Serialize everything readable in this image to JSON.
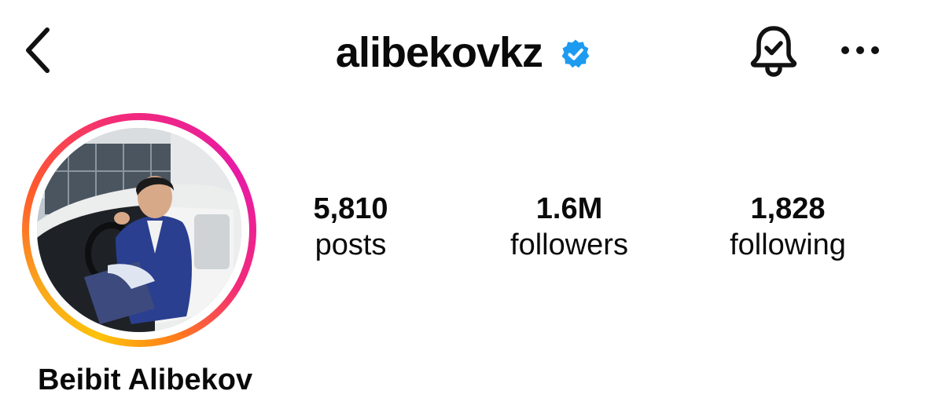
{
  "header": {
    "username": "alibekovkz",
    "verified": true,
    "icons": {
      "back": "chevron-left-icon",
      "verified": "verified-badge-icon",
      "notifications": "bell-check-icon",
      "more": "more-horizontal-icon"
    },
    "colors": {
      "verified_badge": "#1d9bf0"
    }
  },
  "profile": {
    "full_name": "Beibit Alibekov",
    "story_ring_colors": [
      "#fdc20a",
      "#ff5a2c",
      "#e71ba6"
    ]
  },
  "stats": {
    "posts": {
      "value": "5,810",
      "label": "posts"
    },
    "followers": {
      "value": "1.6M",
      "label": "followers"
    },
    "following": {
      "value": "1,828",
      "label": "following"
    }
  }
}
